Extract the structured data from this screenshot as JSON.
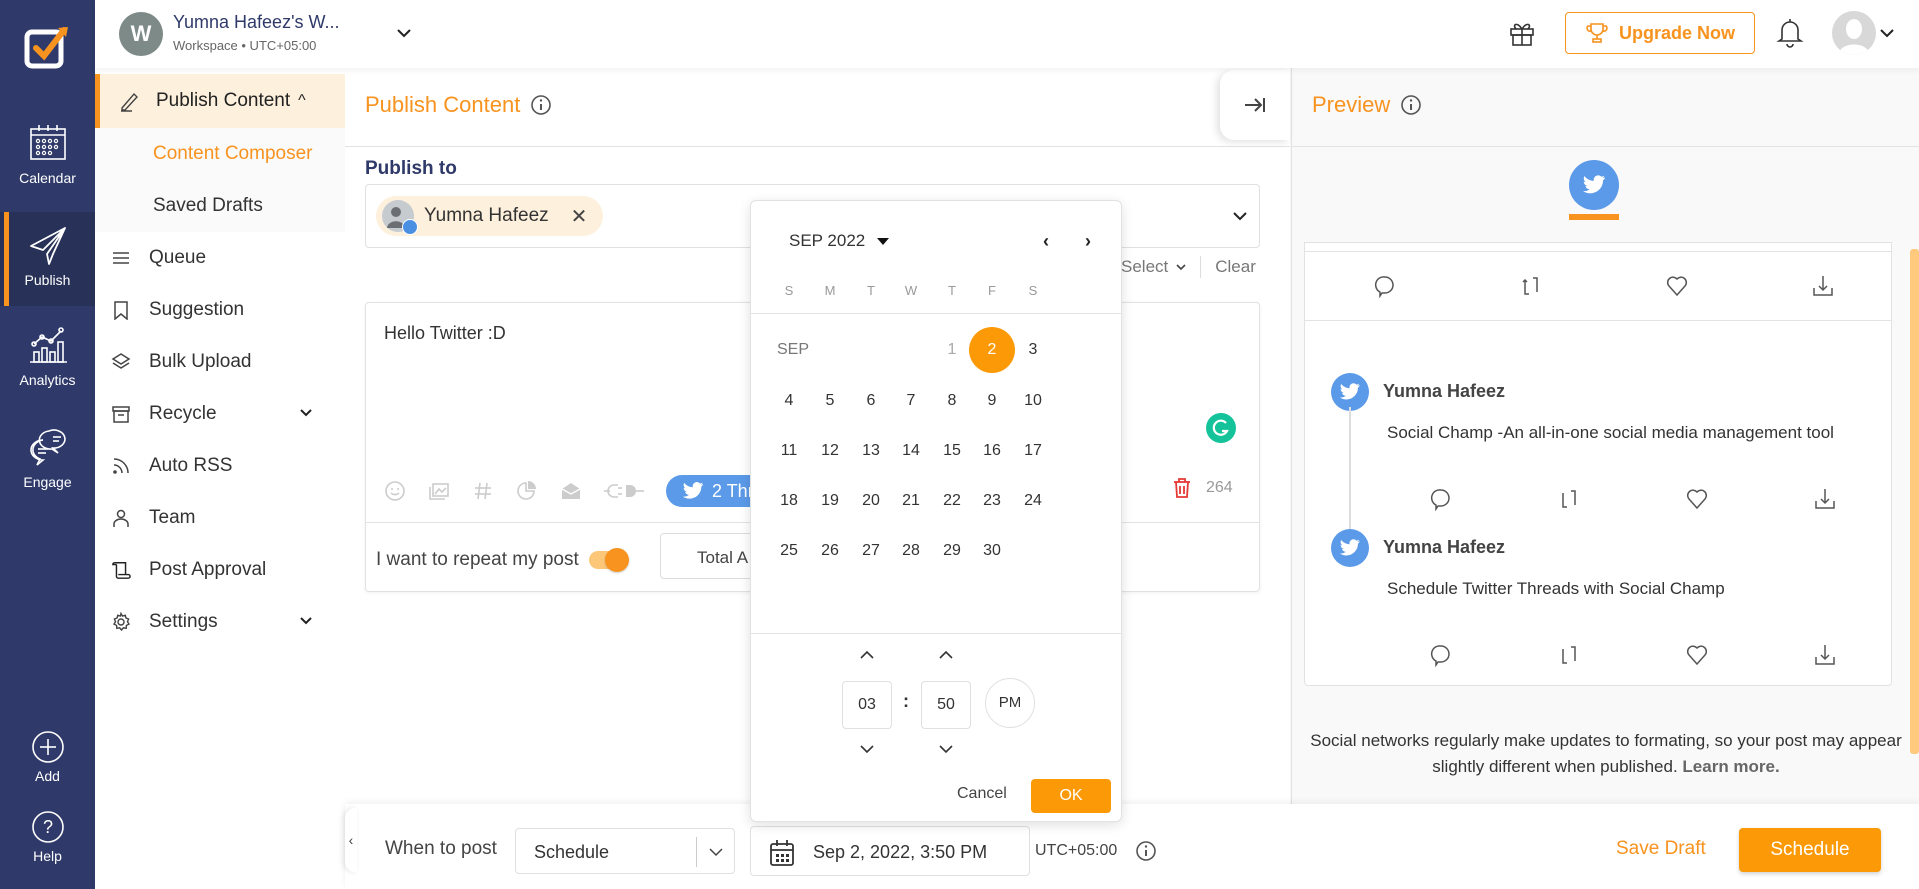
{
  "rail": {
    "items": [
      {
        "label": "Calendar",
        "icon": "calendar-icon"
      },
      {
        "label": "Publish",
        "icon": "paper-plane-icon",
        "active": true
      },
      {
        "label": "Analytics",
        "icon": "analytics-icon"
      },
      {
        "label": "Engage",
        "icon": "chat-bubbles-icon"
      }
    ],
    "add_label": "Add",
    "help_label": "Help"
  },
  "workspace": {
    "initial": "W",
    "name": "Yumna Hafeez's W...",
    "subtitle": "Workspace • UTC+05:00"
  },
  "header": {
    "upgrade_label": "Upgrade Now"
  },
  "sidebar": {
    "parent": {
      "label": "Publish Content",
      "caret": "^"
    },
    "subitems": [
      {
        "label": "Content Composer",
        "active": true
      },
      {
        "label": "Saved Drafts"
      }
    ],
    "items": [
      {
        "label": "Queue",
        "icon": "list-icon"
      },
      {
        "label": "Suggestion",
        "icon": "bookmark-icon"
      },
      {
        "label": "Bulk Upload",
        "icon": "layers-icon"
      },
      {
        "label": "Recycle",
        "icon": "archive-box-icon",
        "has_chevron": true
      },
      {
        "label": "Auto RSS",
        "icon": "rss-icon"
      },
      {
        "label": "Team",
        "icon": "person-icon"
      },
      {
        "label": "Post Approval",
        "icon": "scroll-icon"
      },
      {
        "label": "Settings",
        "icon": "gear-icon",
        "has_chevron": true
      }
    ]
  },
  "composer": {
    "title": "Publish Content",
    "publish_to_label": "Publish to",
    "selected_account": "Yumna Hafeez",
    "select_label": "Select",
    "clear_label": "Clear",
    "post_text": "Hello Twitter :D",
    "thread_label": "2 Threads",
    "char_count": "264",
    "repeat_label": "I want to repeat my post",
    "repeat_enabled": true,
    "total_label": "Total A"
  },
  "calendar": {
    "month_label": "SEP 2022",
    "row_month_label": "SEP",
    "weekdays": [
      "S",
      "M",
      "T",
      "W",
      "T",
      "F",
      "S"
    ],
    "weeks": [
      [
        "",
        "",
        "",
        "",
        "1",
        "2",
        "3"
      ],
      [
        "4",
        "5",
        "6",
        "7",
        "8",
        "9",
        "10"
      ],
      [
        "11",
        "12",
        "13",
        "14",
        "15",
        "16",
        "17"
      ],
      [
        "18",
        "19",
        "20",
        "21",
        "22",
        "23",
        "24"
      ],
      [
        "25",
        "26",
        "27",
        "28",
        "29",
        "30",
        ""
      ]
    ],
    "selected_day": "2",
    "hour": "03",
    "minute": "50",
    "ampm": "PM",
    "cancel_label": "Cancel",
    "ok_label": "OK"
  },
  "preview": {
    "title": "Preview",
    "tweets": [
      {
        "name": "Yumna Hafeez",
        "text": "Social Champ -An all-in-one social media management tool"
      },
      {
        "name": "Yumna Hafeez",
        "text": "Schedule Twitter Threads with Social Champ"
      }
    ],
    "note": "Social networks regularly make updates to formating, so your post may appear slightly different when published.",
    "learn_more": "Learn more."
  },
  "bottom": {
    "when_label": "When to post",
    "schedule_option": "Schedule",
    "datetime": "Sep 2, 2022, 3:50 PM",
    "timezone": "UTC+05:00",
    "save_draft_label": "Save Draft",
    "schedule_label": "Schedule"
  },
  "colors": {
    "accent": "#f7931e",
    "rail": "#2f3a6a",
    "twitter": "#5b9ae8",
    "grammarly": "#15c39a",
    "danger": "#e53935"
  }
}
